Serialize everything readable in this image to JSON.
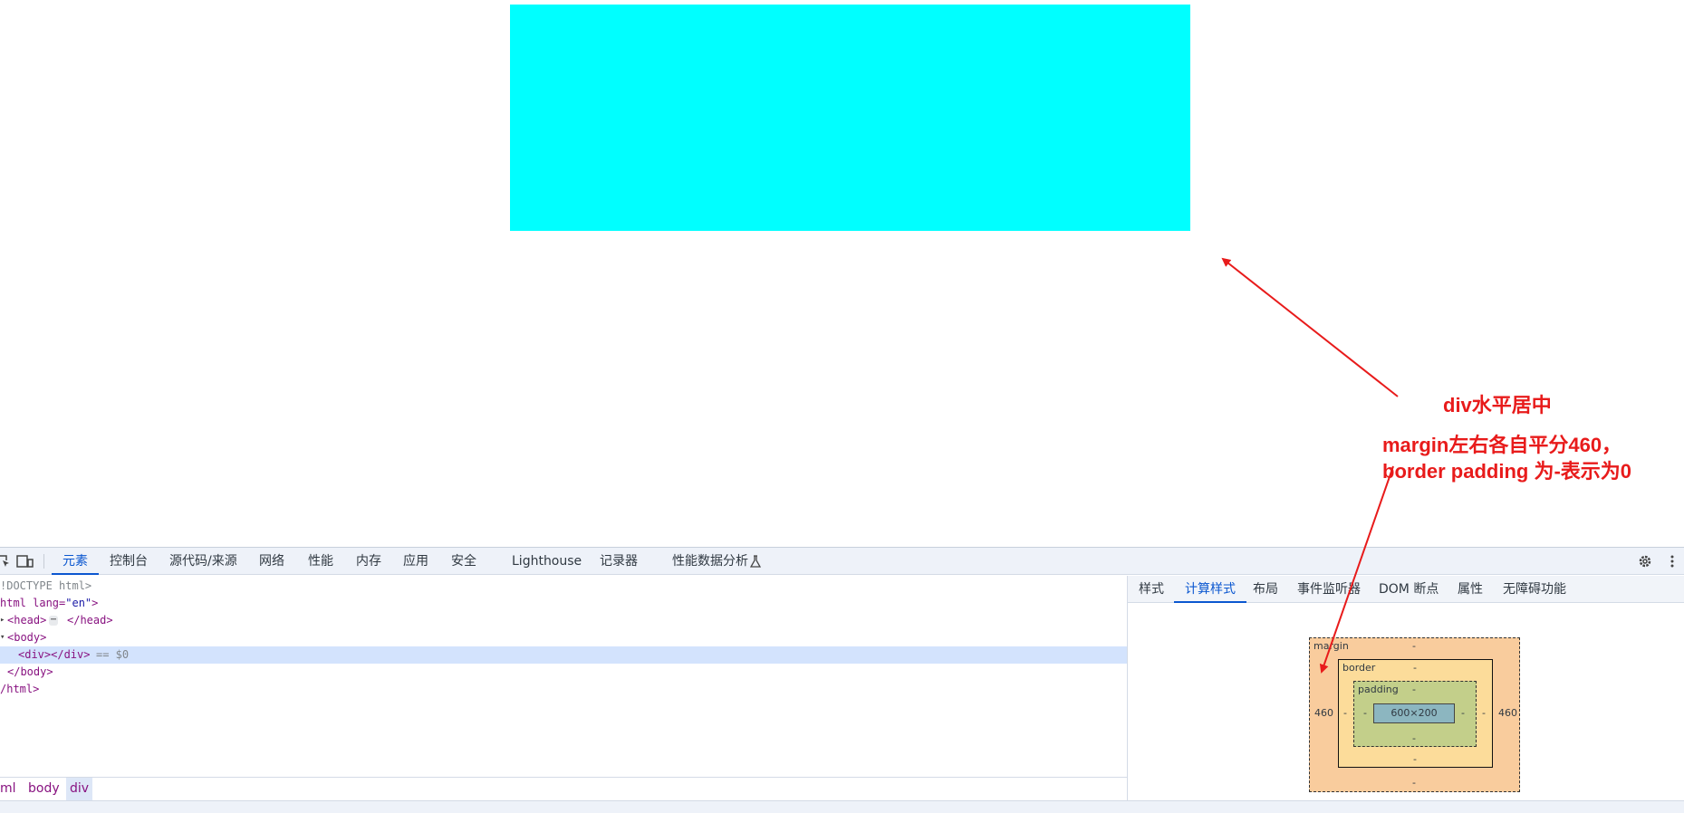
{
  "viewport": {
    "annotation_title": "div水平居中",
    "annotation_line1": "margin左右各自平分460，",
    "annotation_line2": "border padding 为-表示为0"
  },
  "devtools": {
    "tabs": [
      "元素",
      "控制台",
      "源代码/来源",
      "网络",
      "性能",
      "内存",
      "应用",
      "安全",
      "Lighthouse",
      "记录器",
      "性能数据分析"
    ],
    "active_tab": "元素",
    "tree": {
      "doctype": "!DOCTYPE html>",
      "html_open_tag": "html lang=",
      "html_lang": "\"en\"",
      "html_open_end": ">",
      "head": "<head>",
      "head_ellipsis": "⋯",
      "head_close": "</head>",
      "body_open": "<body>",
      "div_line": "<div></div>",
      "div_suffix": "== $0",
      "body_close": "</body>",
      "html_close": "/html>"
    },
    "breadcrumbs": [
      "ml",
      "body",
      "div"
    ],
    "active_breadcrumb": "div",
    "sidebar_tabs": [
      "样式",
      "计算样式",
      "布局",
      "事件监听器",
      "DOM 断点",
      "属性",
      "无障碍功能"
    ],
    "active_sidebar_tab": "计算样式",
    "box_model": {
      "margin_label": "margin",
      "margin_top": "-",
      "margin_bottom": "-",
      "margin_left": "460",
      "margin_right": "460",
      "border_label": "border",
      "border_top": "-",
      "border_bottom": "-",
      "border_left": "-",
      "border_right": "-",
      "padding_label": "padding",
      "padding_top": "-",
      "padding_bottom": "-",
      "padding_left": "-",
      "padding_right": "-",
      "content_size": "600×200"
    }
  },
  "colors": {
    "cyan_box": "#00ffff",
    "annotation": "#e81b1b",
    "active_tab": "#0b57d0",
    "margin": "#f9cc9d",
    "border": "#fcdc9a",
    "padding": "#c3cf8a",
    "content": "#8cb6c0"
  }
}
